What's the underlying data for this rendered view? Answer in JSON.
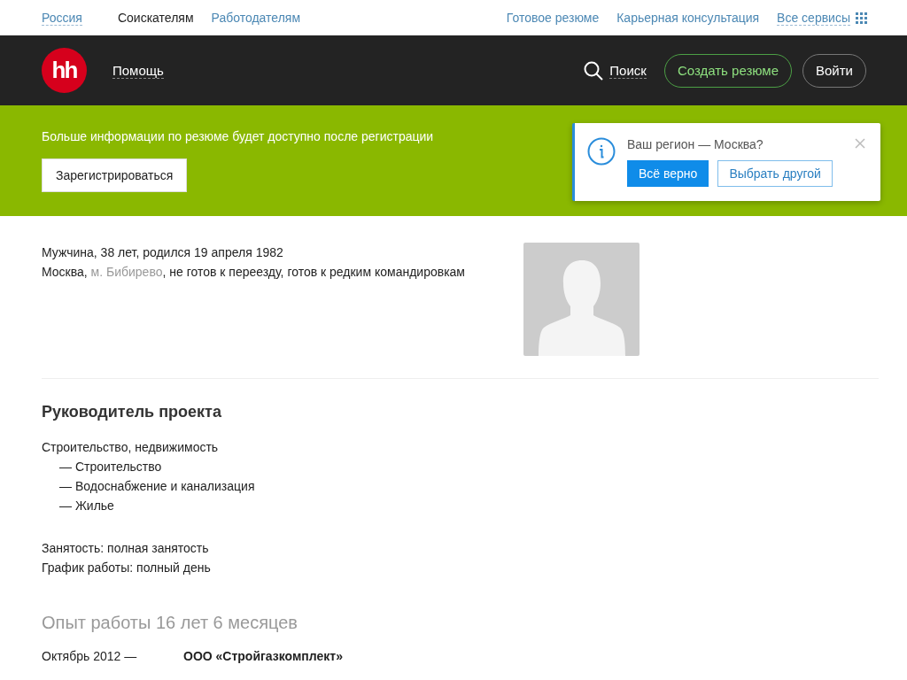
{
  "top_nav": {
    "region": "Россия",
    "audience": [
      {
        "label": "Соискателям",
        "selected": true
      },
      {
        "label": "Работодателям",
        "selected": false
      }
    ],
    "links": [
      "Готовое резюме",
      "Карьерная консультация"
    ],
    "services": "Все сервисы"
  },
  "header": {
    "logo": "hh",
    "help": "Помощь",
    "search": "Поиск",
    "create": "Создать резюме",
    "login": "Войти"
  },
  "banner": {
    "text": "Больше информации по резюме будет доступно после регистрации",
    "button": "Зарегистрироваться"
  },
  "region_popup": {
    "question": "Ваш регион — Москва?",
    "confirm": "Всё верно",
    "other": "Выбрать другой"
  },
  "person": {
    "summary": "Мужчина, 38 лет, родился 19 апреля 1982",
    "city": "Москва, ",
    "metro": "м. Бибирево",
    "relocation": ", не готов к переезду, готов к редким командировкам"
  },
  "position": {
    "title": "Руководитель проекта",
    "field": "Строительство, недвижимость",
    "specializations": [
      "— Строительство",
      "— Водоснабжение и канализация",
      "— Жилье"
    ],
    "employment": "Занятость: полная занятость",
    "schedule": "График работы: полный день"
  },
  "experience": {
    "title": "Опыт работы 16 лет 6 месяцев",
    "jobs": [
      {
        "period": "Октябрь 2012 —",
        "company": "ООО «Стройгазкомплект»"
      }
    ]
  }
}
